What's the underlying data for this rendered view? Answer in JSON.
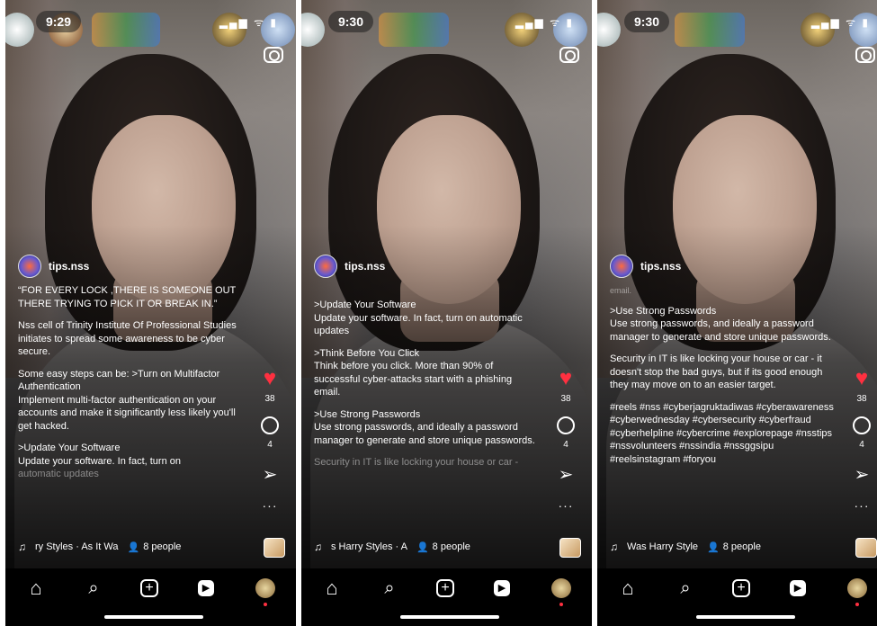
{
  "colors": {
    "like_red": "#ff3040",
    "nav_bg": "#000000"
  },
  "common": {
    "username": "tips.nss",
    "likes": "38",
    "comments": "4",
    "people": "8 people",
    "nav_icons": [
      "home-icon",
      "search-icon",
      "create-icon",
      "reels-icon",
      "profile-icon"
    ]
  },
  "screens": [
    {
      "time": "9:29",
      "caption": {
        "quote": "“FOR EVERY LOCK ,THERE IS SOMEONE OUT THERE TRYING TO PICK IT OR BREAK IN.”",
        "intro": "Nss cell of Trinity Institute Of Professional Studies initiates to spread some awareness to be cyber secure.",
        "steps_head": "Some easy steps can be: >Turn on Multifactor Authentication",
        "mfa_body": "Implement multi-factor authentication on your accounts and make it significantly less likely you'll get hacked.",
        "update_head": ">Update Your Software",
        "update_body_1": "Update your software. In fact, turn on",
        "update_body_2": "automatic updates"
      },
      "music": "ry Styles · As It Wa"
    },
    {
      "time": "9:30",
      "caption": {
        "update_head": ">Update Your Software",
        "update_body": "Update your software. In fact, turn on automatic updates",
        "think_head": ">Think Before You Click",
        "think_body": "Think before you click. More than 90% of successful cyber-attacks start with a phishing email.",
        "pw_head": ">Use Strong Passwords",
        "pw_body": "Use strong passwords, and ideally a password manager to generate and store unique passwords.",
        "security_faded": "Security in IT is like locking your house or car -"
      },
      "music": "s    Harry Styles · A"
    },
    {
      "time": "9:30",
      "caption": {
        "faded_top": "email.",
        "pw_head": ">Use Strong Passwords",
        "pw_body": "Use strong passwords, and ideally a password manager to generate and store unique passwords.",
        "security": "Security in IT is like locking your house or car - it doesn't stop the bad guys, but if its good enough they may move on to an easier target.",
        "hashtags": "#reels #nss #cyberjagruktadiwas #cyberawareness #cyberwednesday #cybersecurity #cyberfraud #cyberhelpline #cybercrime #explorepage #nsstips #nssvolunteers #nssindia #nssggsipu #reelsinstagram #foryou"
      },
      "music": "Was    Harry Style"
    }
  ]
}
